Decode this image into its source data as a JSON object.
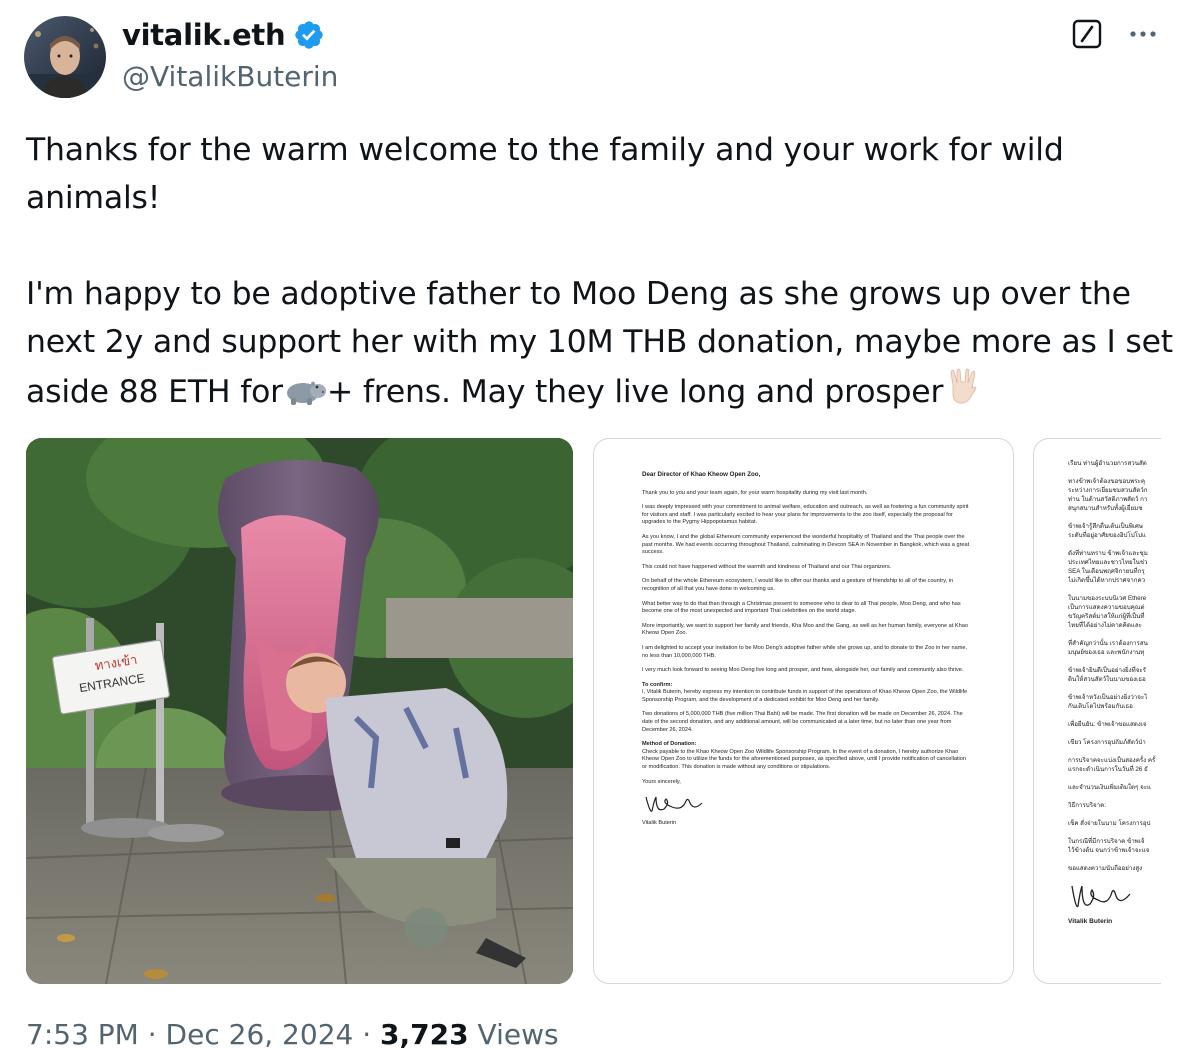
{
  "author": {
    "display_name": "vitalik.eth",
    "handle": "@VitalikButerin",
    "verified_color": "#1d9bf0"
  },
  "actions": {
    "grok_icon": "grok-icon",
    "more_icon": "more-icon"
  },
  "tweet": {
    "line1": "Thanks for the warm welcome to the family and your work for wild",
    "line2": "animals!",
    "line3": "I'm happy to be adoptive father to Moo Deng as she grows up over the",
    "line4": "next 2y and support her with my 10M THB donation, maybe more as I set",
    "line5_a": "aside 88 ETH for",
    "line5_b": "+ frens. May they live long and prosper",
    "emoji_hippo": "hippo-emoji",
    "emoji_vulcan": "vulcan-salute-emoji"
  },
  "photo": {
    "sign_thai": "ทางเข้า",
    "sign_en": "ENTRANCE"
  },
  "letter": {
    "salutation": "Dear Director of Khao Kheow Open Zoo,",
    "p1": "Thank you to you and your team again, for your warm hospitality during my visit last month.",
    "p2": "I was deeply impressed with your commitment to animal welfare, education and outreach, as well as fostering a fun community spirit for visitors and staff. I was particularly excited to hear your plans for improvements to the zoo itself, especially the proposal for upgrades to the Pygmy Hippopotamus habitat.",
    "p3": "As you know, I and the global Ethereum community experienced the wonderful hospitality of Thailand and the Thai people over the past months. We had events occurring throughout Thailand, culminating in Devcon SEA in November in Bangkok, which was a great success.",
    "p4": "This could not have happened without the warmth and kindness of Thailand and our Thai organizers.",
    "p5": "On behalf of the whole Ethereum ecosystem, I would like to offer our thanks and a gesture of friendship to all of the country, in recognition of all that you have done in welcoming us.",
    "p6": "What better way to do that than through a Christmas present to someone who is dear to all Thai people, Moo Deng, and who has become one of the most unexpected and important Thai celebrities on the world stage.",
    "p7": "More importantly, we want to support her family and friends, Kha Moo and the Gang, as well as her human family, everyone at Khao Kheow Open Zoo.",
    "p8": "I am delighted to accept your invitation to be Moo Deng's adoptive father while she grows up, and to donate to the Zoo in her name, no less than 10,000,000 THB.",
    "p9": "I very much look forward to seeing Moo Deng live long and prosper, and how, alongside her, our family and community also thrive.",
    "confirm_head": "To confirm:",
    "confirm_body": "I, Vitalik Buterin, hereby express my intention to contribute funds in support of the operations of Khao Kheow Open Zoo, the Wildlife Sponsorship Program, and the development of a dedicated exhibit for Moo Deng and her family.",
    "p10": "Two donations of 5,000,000 THB (five million Thai Baht) will be made. The first donation will be made on December 26, 2024. The date of the second donation, and any additional amount, will be communicated at a later time, but no later than one year from December 26, 2024.",
    "method_head": "Method of Donation:",
    "method_body": "Check payable to the Khao Kheow Open Zoo Wildlife Sponsorship Program. In the event of a donation, I hereby authorize Khao Kheow Open Zoo to utilize the funds for the aforementioned purposes, as specified above, until I provide notification of cancellation or modification. This donation is made without any conditions or stipulations.",
    "closing": "Yours sincerely,",
    "signer": "Vitalik Buterin"
  },
  "letter_thai": {
    "l1": "เรียน ท่านผู้อำนวยการสวนสัต",
    "l2": "ทางข้าพเจ้าต้องขอขอบพระคุ",
    "l3": "ระหว่างการเยี่ยมชมสวนสัตว์ก",
    "l4": "ท่าน ในด้านสวัสดิภาพสัตว์ กา",
    "l5": "สนุกสนานสำหรับทั้งผู้เยี่ยมช",
    "l6": "ข้าพเจ้ารู้สึกตื่นเต้นเป็นพิเศษ",
    "l7": "ระดับที่อยู่อาศัยของฮิปโปโปแ",
    "l8": "ดังที่ท่านทราบ ข้าพเจ้าและชุม",
    "l9": "ประเทศไทยและชาวไทยในช่ว",
    "l10": "SEA ในเดือนพฤศจิกายนที่กรุ",
    "l11": "ไม่เกิดขึ้นได้หากปราศจากคว",
    "l12": "ในนามของระบบนิเวศ Ethere",
    "l13": "เป็นการแสดงความขอบคุณต่",
    "l14": "ขวัญคริสต์มาสให้แก่ผู้ที่เป็นที่",
    "l15": "ไทยที่ได้อย่างไม่คาดคิดและ",
    "l16": "ที่สำคัญกว่านั้น เราต้องการสน",
    "l17": "มนุษย์ของเธอ และพนักงานทุ",
    "l18": "ข้าพเจ้ายินดีเป็นอย่างยิ่งที่จะรั",
    "l19": "ดินให้สวนสัตว์ในนามของเธอ",
    "l20": "ข้าพเจ้าหวังเป็นอย่างยิ่งว่าจะไ",
    "l21": "กันเติบโตไปพร้อมกับเธอ",
    "l22": "เพื่อยืนยัน: ข้าพเจ้าขอแสดงเจ",
    "l23": "เขียว โครงการอุปถัมภ์สัตว์ป่า",
    "l24": "การบริจาคจะแบ่งเป็นสองครั้ง ครั้",
    "l25": "แรกจะดำเนินการในวันที่ 26 ธั",
    "l26": "และจำนวนเงินเพิ่มเติมใดๆ จะแ",
    "l27": "วิธีการบริจาค:",
    "l28": "เช็ค สั่งจ่ายในนาม โครงการอุป",
    "l29": "ในกรณีที่มีการบริจาค ข้าพเจ้",
    "l30": "ไว้ข้างต้น จนกว่าข้าพเจ้าจะแจ",
    "l31": "ขอแสดงความนับถืออย่างสูง",
    "signer": "Vitalik Buterin"
  },
  "footer": {
    "time": "7:53 PM",
    "date": "Dec 26, 2024",
    "view_count": "3,723",
    "views_label": "Views"
  }
}
